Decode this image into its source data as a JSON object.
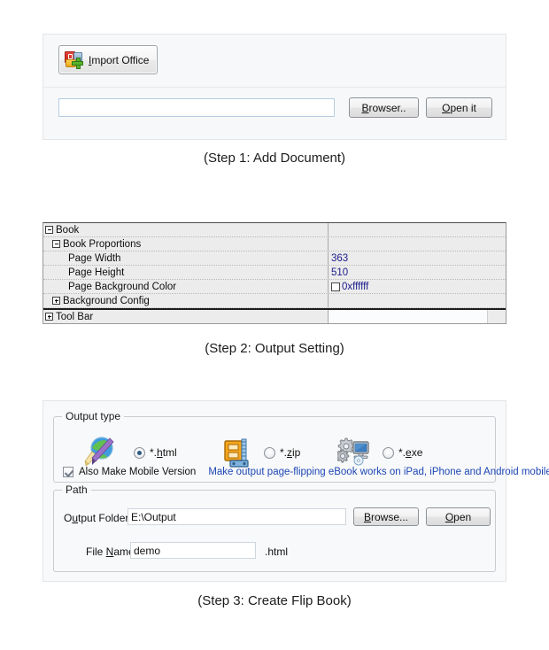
{
  "step1": {
    "import_button_label": "Import Office",
    "import_button_icon": "office-import-icon",
    "path_value": "",
    "path_placeholder": "",
    "browser_button_label": "Browser..",
    "open_it_button_label": "Open it",
    "caption": "(Step 1: Add Document)"
  },
  "step2": {
    "caption": "(Step 2: Output Setting)",
    "grid": {
      "rows": [
        {
          "name": "Book",
          "value": "",
          "level": 0,
          "expander": "minus"
        },
        {
          "name": "Book Proportions",
          "value": "",
          "level": 1,
          "expander": "minus"
        },
        {
          "name": "Page Width",
          "value": "363",
          "level": 2,
          "expander": "none"
        },
        {
          "name": "Page Height",
          "value": "510",
          "level": 2,
          "expander": "none"
        },
        {
          "name": "Page Background Color",
          "value": "0xffffff",
          "level": 2,
          "expander": "none",
          "swatch": "#ffffff"
        },
        {
          "name": "Background Config",
          "value": "",
          "level": 1,
          "expander": "plus"
        },
        {
          "name": "Tool Bar",
          "value": "",
          "level": 0,
          "expander": "plus"
        }
      ]
    }
  },
  "step3": {
    "caption": "(Step 3: Create Flip Book)",
    "output_type": {
      "group_title": "Output type",
      "options": [
        {
          "label": "*.html",
          "accesskey": "h",
          "icon": "globe-brush-icon",
          "selected": true
        },
        {
          "label": "*.zip",
          "accesskey": "z",
          "icon": "zip-archive-icon",
          "selected": false
        },
        {
          "label": "*.exe",
          "accesskey": "e",
          "icon": "gears-computer-icon",
          "selected": false
        }
      ],
      "mobile_checkbox_label": "Also Make Mobile Version",
      "mobile_checkbox_checked": true,
      "mobile_hint": "Make output page-flipping eBook works on iPad, iPhone and Android mobile devices",
      "mobile_hint_color": "#1c46b4"
    },
    "path": {
      "group_title": "Path",
      "output_folder_label_pre": "O",
      "output_folder_label_key": "u",
      "output_folder_label_post": "tput Folder:",
      "output_folder_value": "E:\\Output",
      "browse_button_label": "Browse...",
      "open_button_label": "Open",
      "file_name_label_pre": "File ",
      "file_name_label_key": "N",
      "file_name_label_post": "ame:",
      "file_name_value": "demo",
      "file_extension": ".html"
    }
  }
}
